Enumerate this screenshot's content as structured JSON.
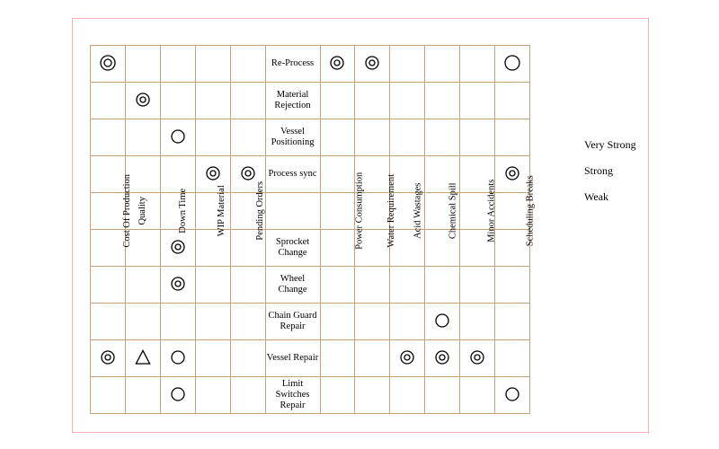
{
  "chart_data": {
    "type": "table",
    "title": "Relationship Matrix",
    "symbols": {
      "very_strong": "double-circle",
      "strong": "circle",
      "weak": "triangle"
    },
    "columns": [
      "Cost Of Production",
      "Quality",
      "Down Time",
      "WIP Material",
      "Pending Orders",
      "Power Consumption",
      "Water Requirement",
      "Acid Wastages",
      "Chemical Spill",
      "Minor Accidents",
      "Scheduling Breaks"
    ],
    "rows": [
      "Re-Process",
      "Material Rejection",
      "Vessel Positioning",
      "Process sync",
      "Sprocket Change",
      "Wheel Change",
      "Chain Guard Repair",
      "Vessel Repair",
      "Limit Switches Repair"
    ],
    "matrix": [
      [
        "very_strong",
        "",
        "",
        "",
        "",
        "very_strong",
        "very_strong",
        "",
        "",
        "",
        "strong"
      ],
      [
        "",
        "very_strong",
        "",
        "",
        "",
        "",
        "",
        "",
        "",
        "",
        ""
      ],
      [
        "",
        "",
        "strong",
        "",
        "",
        "",
        "",
        "",
        "",
        "",
        ""
      ],
      [
        "",
        "",
        "",
        "very_strong",
        "very_strong",
        "",
        "",
        "",
        "",
        "",
        "very_strong"
      ],
      [
        "",
        "",
        "very_strong",
        "",
        "",
        "",
        "",
        "",
        "",
        "",
        ""
      ],
      [
        "",
        "",
        "very_strong",
        "",
        "",
        "",
        "",
        "",
        "",
        "",
        ""
      ],
      [
        "",
        "",
        "",
        "",
        "",
        "",
        "",
        "",
        "strong",
        "",
        ""
      ],
      [
        "very_strong",
        "weak",
        "strong",
        "",
        "",
        "",
        "",
        "very_strong",
        "very_strong",
        "very_strong",
        ""
      ],
      [
        "",
        "",
        "strong",
        "",
        "",
        "",
        "",
        "",
        "",
        "",
        "strong"
      ]
    ]
  },
  "legend": {
    "very_strong": "Very Strong",
    "strong": "Strong",
    "weak": "Weak"
  }
}
